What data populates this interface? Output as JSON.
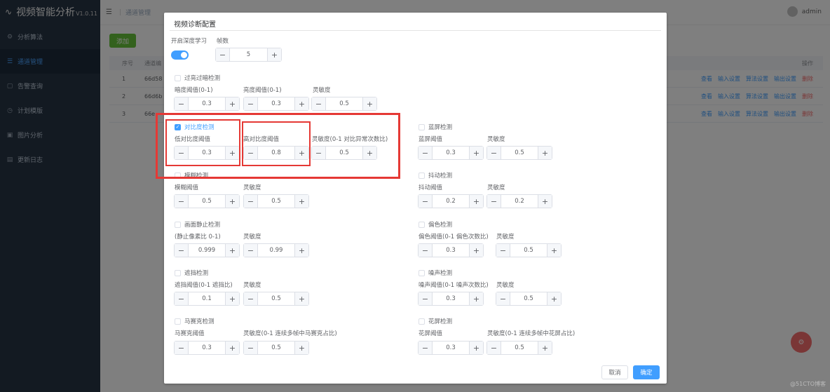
{
  "app": {
    "title": "视频智能分析",
    "version": "V1.0.11"
  },
  "sidebar": {
    "items": [
      {
        "label": "分析算法",
        "icon": "algorithm-icon"
      },
      {
        "label": "通道管理",
        "icon": "list-icon",
        "active": true
      },
      {
        "label": "告警查询",
        "icon": "alarm-icon"
      },
      {
        "label": "计划模版",
        "icon": "plan-icon"
      },
      {
        "label": "图片分析",
        "icon": "image-icon"
      },
      {
        "label": "更新日志",
        "icon": "log-icon"
      }
    ]
  },
  "topbar": {
    "breadcrumb": "通道管理",
    "user": "admin"
  },
  "main": {
    "add_label": "添加",
    "table": {
      "headers": {
        "index": "序号",
        "code": "通道编",
        "ops": "操作"
      },
      "rows": [
        {
          "index": "1",
          "code": "66d58"
        },
        {
          "index": "2",
          "code": "66d6b"
        },
        {
          "index": "3",
          "code": "66e"
        }
      ],
      "ops": [
        "查看",
        "输入设置",
        "算法设置",
        "输出设置",
        "删除"
      ]
    }
  },
  "dialog": {
    "title": "视频诊断配置",
    "deep_learning_label": "开启深度学习",
    "deep_learning_on": true,
    "frames_label": "帧数",
    "frames_value": "5",
    "sections": {
      "overdark": {
        "title": "过亮过暗检测",
        "checked": false,
        "fields": [
          {
            "label": "暗度阈值(0-1)",
            "value": "0.3"
          },
          {
            "label": "亮度阈值(0-1)",
            "value": "0.3"
          },
          {
            "label": "灵敏度",
            "value": "0.5"
          }
        ]
      },
      "contrast": {
        "title": "对比度检测",
        "checked": true,
        "fields": [
          {
            "label": "低对比度阈值",
            "value": "0.3"
          },
          {
            "label": "高对比度阈值",
            "value": "0.8"
          },
          {
            "label": "灵敏度(0-1 对比异常次数比)",
            "value": "0.5"
          }
        ]
      },
      "bluescreen": {
        "title": "蓝屏检测",
        "checked": false,
        "fields": [
          {
            "label": "蓝屏阈值",
            "value": "0.3"
          },
          {
            "label": "灵敏度",
            "value": "0.5"
          }
        ]
      },
      "blur": {
        "title": "模糊检测",
        "checked": false,
        "fields": [
          {
            "label": "模糊阈值",
            "value": "0.5"
          },
          {
            "label": "灵敏度",
            "value": "0.5"
          }
        ]
      },
      "shake": {
        "title": "抖动检测",
        "checked": false,
        "fields": [
          {
            "label": "抖动阈值",
            "value": "0.2"
          },
          {
            "label": "灵敏度",
            "value": "0.2"
          }
        ]
      },
      "freeze": {
        "title": "画面静止检测",
        "checked": false,
        "fields": [
          {
            "label": "(静止像素比 0-1)",
            "value": "0.999"
          },
          {
            "label": "灵敏度",
            "value": "0.99"
          }
        ]
      },
      "colorcast": {
        "title": "偏色检测",
        "checked": false,
        "fields": [
          {
            "label": "偏色阈值(0-1 偏色次数比)",
            "value": "0.3"
          },
          {
            "label": "灵敏度",
            "value": "0.5"
          }
        ]
      },
      "occlusion": {
        "title": "遮挡检测",
        "checked": false,
        "fields": [
          {
            "label": "遮挡阈值(0-1 遮挡比)",
            "value": "0.1"
          },
          {
            "label": "灵敏度",
            "value": "0.5"
          }
        ]
      },
      "noise": {
        "title": "噪声检测",
        "checked": false,
        "fields": [
          {
            "label": "噪声阈值(0-1 噪声次数比)",
            "value": "0.3"
          },
          {
            "label": "灵敏度",
            "value": "0.5"
          }
        ]
      },
      "mosaic": {
        "title": "马赛克检测",
        "checked": false,
        "fields": [
          {
            "label": "马赛克阈值",
            "value": "0.3"
          },
          {
            "label": "灵敏度(0-1 连续多帧中马赛克占比)",
            "value": "0.5"
          }
        ]
      },
      "glitch": {
        "title": "花屏检测",
        "checked": false,
        "fields": [
          {
            "label": "花屏阈值",
            "value": "0.3"
          },
          {
            "label": "灵敏度(0-1 连续多帧中花屏占比)",
            "value": "0.5"
          }
        ]
      }
    },
    "cancel_label": "取消",
    "ok_label": "确定"
  },
  "watermark": "@51CTO博客",
  "colors": {
    "primary": "#409eff",
    "highlight": "#e53935",
    "sidebar": "#263445",
    "success": "#67c23a",
    "danger": "#f56c6c"
  }
}
